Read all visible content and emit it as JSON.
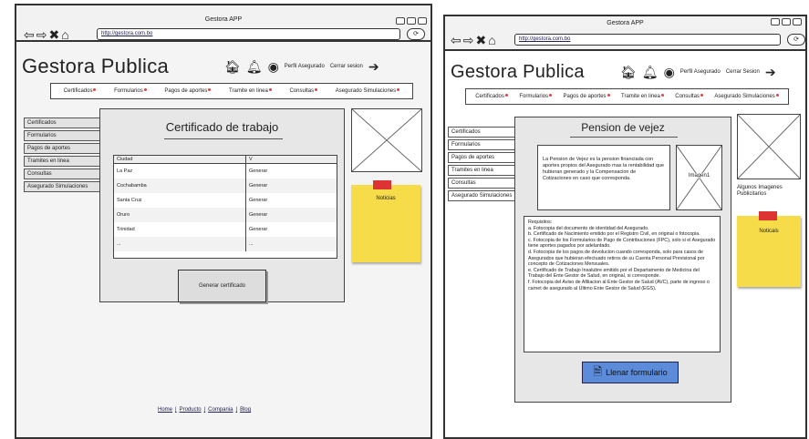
{
  "left": {
    "window_title": "Gestora APP",
    "url": "http://gestora.com.bo",
    "logo": "Gestora Publica",
    "profile_label": "Perfil Asegurado",
    "logout_label": "Cerrar sesion",
    "menu": [
      "Certificados",
      "Formularios",
      "Pagos de aportes",
      "Tramite en linea",
      "Consultas",
      "Asegurado Simulaciones"
    ],
    "sidebar": [
      "Certificados",
      "Formularios",
      "Pagos de aportes",
      "Tramites en linea",
      "Consultas",
      "Asegurado Simulaciones"
    ],
    "panel_title": "Certificado de trabajo",
    "table": {
      "headers": [
        "Ciudad",
        "V"
      ],
      "rows": [
        [
          "La Paz",
          "Generar"
        ],
        [
          "Cochabamba",
          "Generar"
        ],
        [
          "Santa Cruz",
          "Generar"
        ],
        [
          "Oruro",
          "Generar"
        ],
        [
          "Trinidad",
          "Generar"
        ],
        [
          "...",
          "..."
        ]
      ]
    },
    "generate_button": "Generar certificado",
    "note": "Noticias",
    "footer": [
      "Home",
      "Producto",
      "Compania",
      "Blog"
    ]
  },
  "right": {
    "window_title": "Gestora APP",
    "url": "http://gestora.com.bo",
    "logo": "Gestora Publica",
    "profile_label": "Perfil Asegurado",
    "logout_label": "Cerrar Sesion",
    "menu": [
      "Certificados",
      "Formularios",
      "Pagos de aportes",
      "Tramite en linea",
      "Consultas",
      "Asegurado Simulaciones"
    ],
    "sidebar": [
      "Certificados",
      "Formularios",
      "Pagos de aportes",
      "Tramites en linea",
      "Consultas",
      "Asegurado Simulaciones"
    ],
    "panel_title": "Pension de vejez",
    "description": "La Pension de Vejez es la pension financiada con aportes propios del Asegurado mas la rentabilidad que hubieran generado y la Compensacion de Cotizaciones en caso que corresponda.",
    "image_label": "Imagen1",
    "requirements": [
      "Requisitos:",
      "a. Fotocopia del documento de identidad del Asegurado.",
      "b. Certificado de Nacimiento emitido por el Registro Civil, en original o fotocopia.",
      "c. Fotocopia de los Formularios de Pago de Contribuciones (FPC), solo si el Asegurado tiene aportes pagados por adelantado.",
      "d. Fotocopia de los pagos de devolucion cuando corresponda, solo para casos de Asegurados que hubieran efectuado retiros de su Cuenta Personal Previsional por concepto de Cotizaciones Mensuales.",
      "e. Certificado de Trabajo Insalubre emitido por el Departamento de Medicina del Trabajo del Ente Gestor de Salud, en original, si corresponde.",
      "f. Fotocopia del Aviso de Afiliacion al Ente Gestor de Salud (AVC), parte de ingreso o carnet de asegurado al Ultimo Ente Gestor de Salud (EGS)."
    ],
    "fill_button": "Llenar formulario",
    "ads_caption": "Algunos Imagenes Publicitarios",
    "note": "Noticais"
  }
}
